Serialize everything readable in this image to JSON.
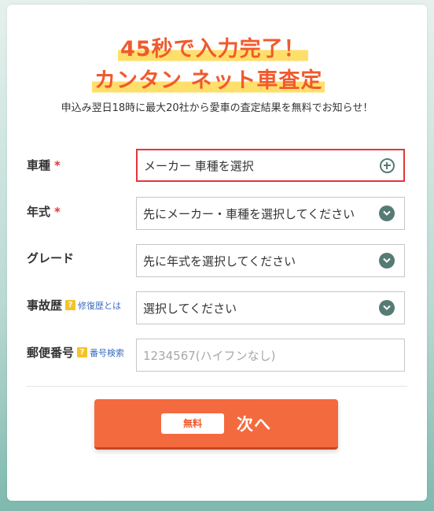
{
  "headline": {
    "line1": "45秒で入力完了！",
    "line2": "カンタン ネット車査定"
  },
  "subtitle": "申込み翌日18時に最大20社から愛車の査定結果を無料でお知らせ！",
  "form": {
    "car_model": {
      "label": "車種",
      "required_mark": "*",
      "value": "メーカー 車種を選択"
    },
    "year": {
      "label": "年式",
      "required_mark": "*",
      "value": "先にメーカー・車種を選択してください"
    },
    "grade": {
      "label": "グレード",
      "value": "先に年式を選択してください"
    },
    "accident": {
      "label": "事故歴",
      "help_mark": "?",
      "help_link": "修復歴とは",
      "value": "選択してください"
    },
    "postal": {
      "label": "郵便番号",
      "help_mark": "?",
      "help_link": "番号検索",
      "placeholder": "1234567(ハイフンなし)"
    }
  },
  "submit": {
    "badge": "無料",
    "label": "次へ"
  },
  "colors": {
    "accent": "#f05a2c",
    "highlight": "#ffdf6b",
    "required": "#e4353a",
    "icon": "#567b74",
    "button": "#f46a3f"
  }
}
